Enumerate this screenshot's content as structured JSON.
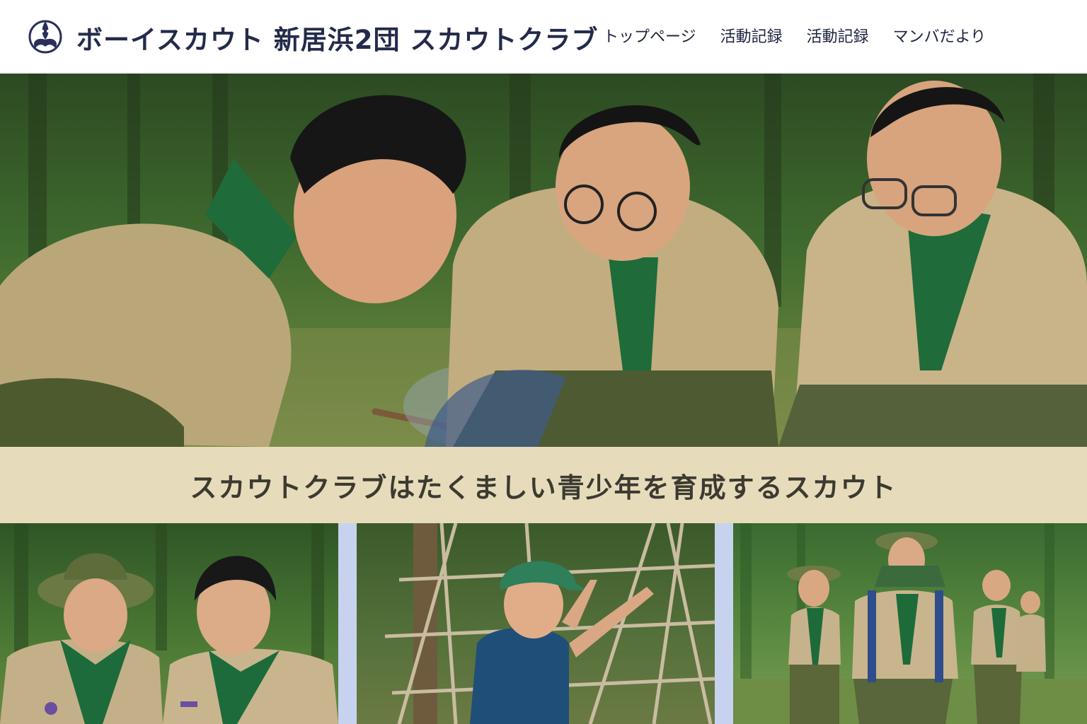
{
  "header": {
    "site_title": "ボーイスカウト 新居浜2団  スカウトクラブ",
    "logo_icon": "fleur-de-lis-logo",
    "nav": [
      "トップページ",
      "活動記録",
      "活動記録",
      "マンバだより"
    ]
  },
  "hero": {
    "image": "scouts-fire-lighting-photo"
  },
  "banner": {
    "text": "スカウトクラブはたくましい青少年を育成するスカウト"
  },
  "gallery": {
    "images": [
      "two-smiling-scouts-photo",
      "child-climbing-rope-net-photo",
      "scouts-hiking-in-forest-photo"
    ]
  },
  "colors": {
    "title": "#232b4a",
    "banner_bg": "#e6dcbb",
    "gallery_gap": "#c7d3ee"
  }
}
